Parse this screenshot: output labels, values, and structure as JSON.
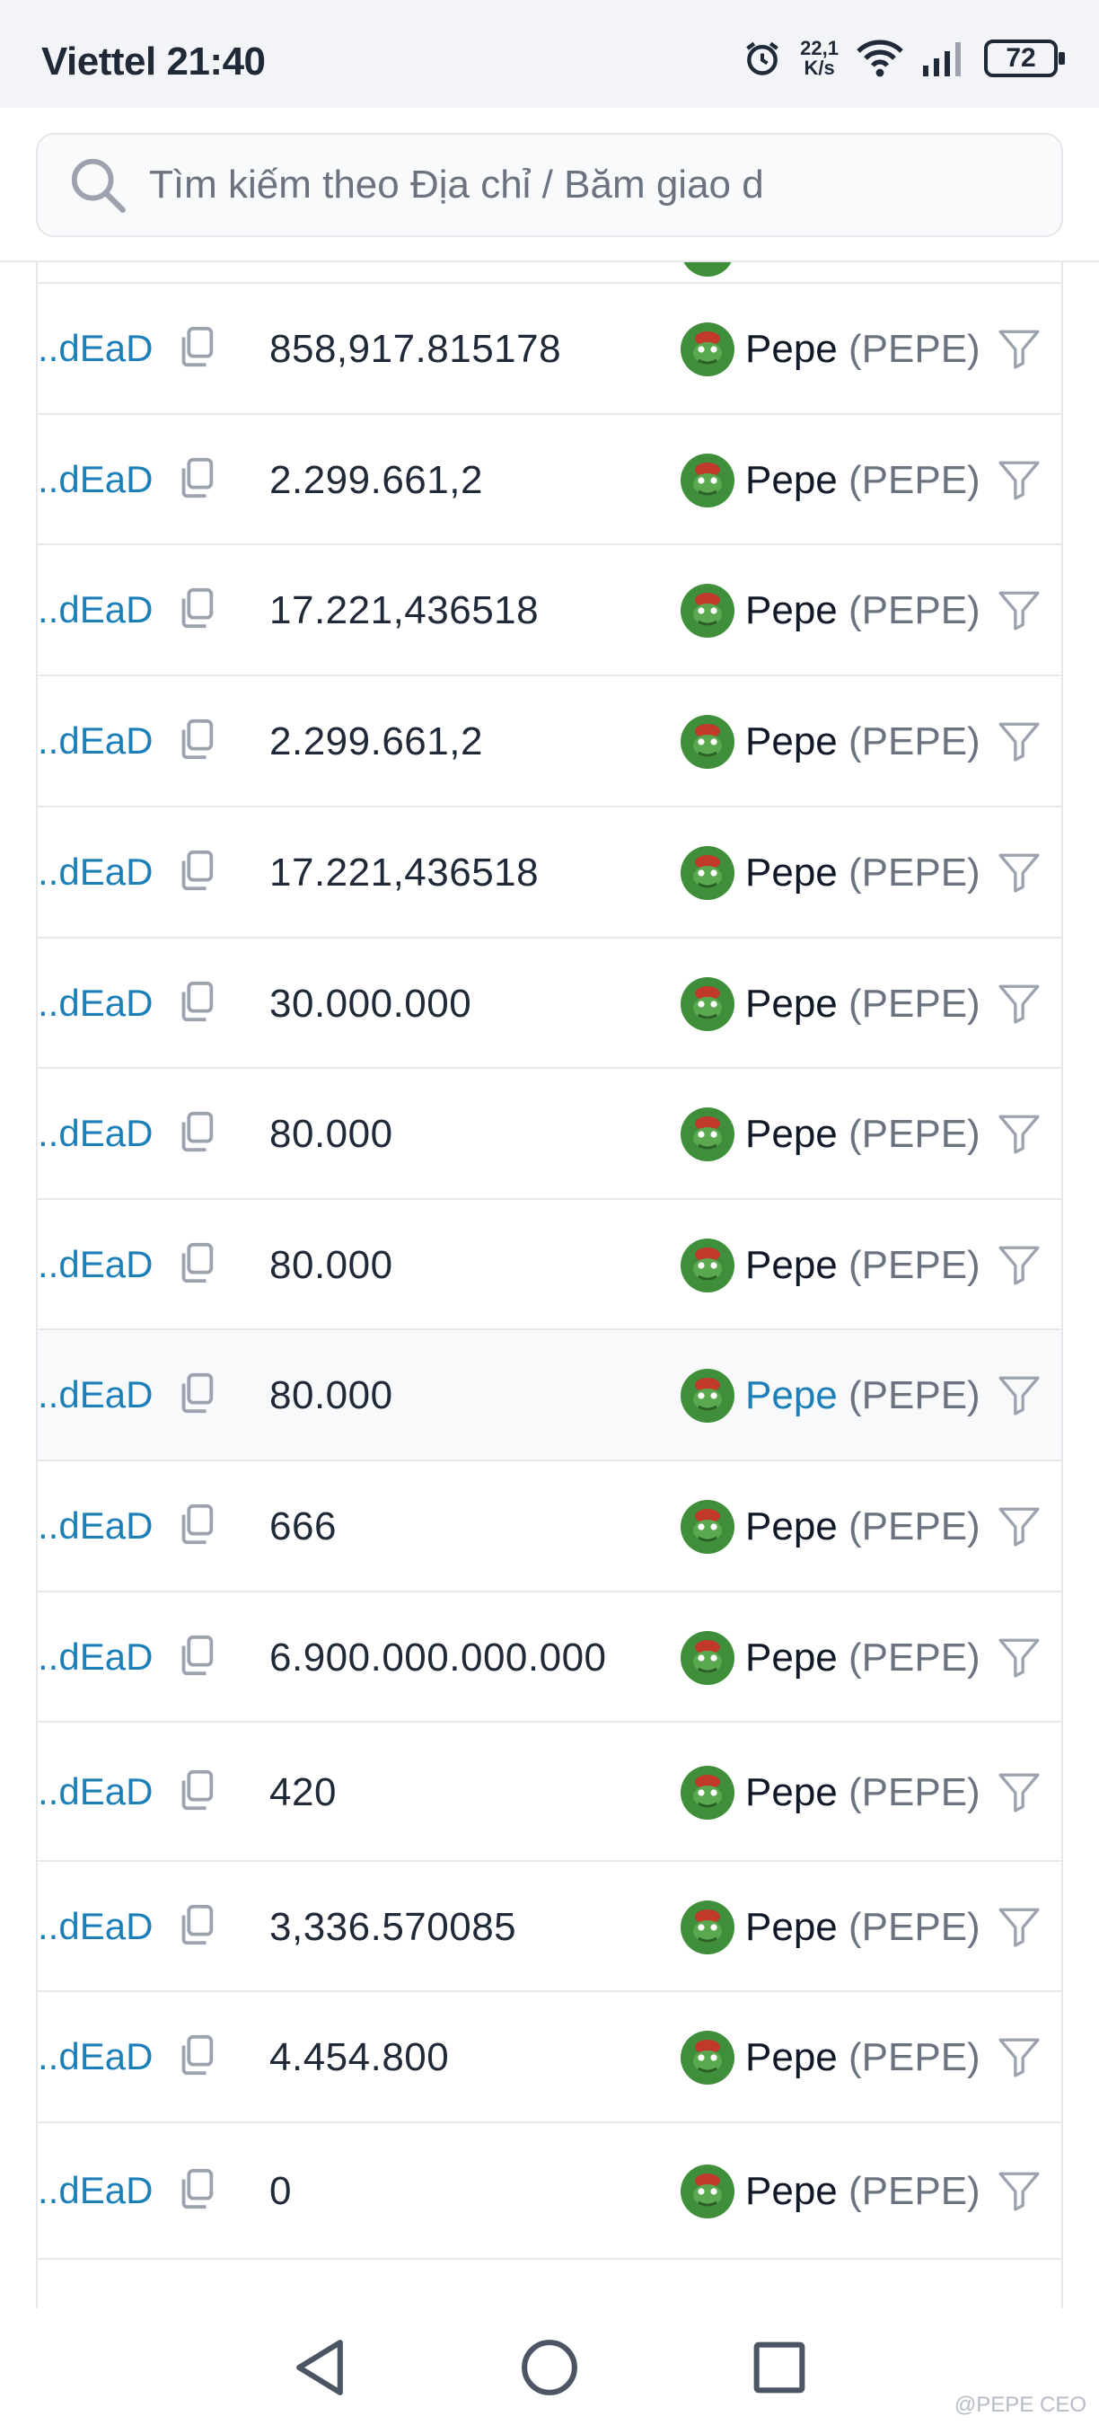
{
  "status_bar": {
    "carrier_time": "Viettel 21:40",
    "net_speed_value": "22,1",
    "net_speed_unit": "K/s",
    "battery": "72"
  },
  "search": {
    "placeholder": "Tìm kiếm theo Địa chỉ / Băm giao d"
  },
  "rows": [
    {
      "address": "..dEaD",
      "amount": "858,917.815178",
      "token_name": "Pepe",
      "token_symbol": "(PEPE)"
    },
    {
      "address": "..dEaD",
      "amount": "2.299.661,2",
      "token_name": "Pepe",
      "token_symbol": "(PEPE)"
    },
    {
      "address": "..dEaD",
      "amount": "17.221,436518",
      "token_name": "Pepe",
      "token_symbol": "(PEPE)"
    },
    {
      "address": "..dEaD",
      "amount": "2.299.661,2",
      "token_name": "Pepe",
      "token_symbol": "(PEPE)"
    },
    {
      "address": "..dEaD",
      "amount": "17.221,436518",
      "token_name": "Pepe",
      "token_symbol": "(PEPE)"
    },
    {
      "address": "..dEaD",
      "amount": "30.000.000",
      "token_name": "Pepe",
      "token_symbol": "(PEPE)"
    },
    {
      "address": "..dEaD",
      "amount": "80.000",
      "token_name": "Pepe",
      "token_symbol": "(PEPE)"
    },
    {
      "address": "..dEaD",
      "amount": "80.000",
      "token_name": "Pepe",
      "token_symbol": "(PEPE)"
    },
    {
      "address": "..dEaD",
      "amount": "80.000",
      "token_name": "Pepe",
      "token_symbol": "(PEPE)",
      "highlighted": true
    },
    {
      "address": "..dEaD",
      "amount": "666",
      "token_name": "Pepe",
      "token_symbol": "(PEPE)"
    },
    {
      "address": "..dEaD",
      "amount": "6.900.000.000.000",
      "token_name": "Pepe",
      "token_symbol": "(PEPE)"
    },
    {
      "address": "..dEaD",
      "amount": "420",
      "token_name": "Pepe",
      "token_symbol": "(PEPE)"
    },
    {
      "address": "..dEaD",
      "amount": "3,336.570085",
      "token_name": "Pepe",
      "token_symbol": "(PEPE)"
    },
    {
      "address": "..dEaD",
      "amount": "4.454.800",
      "token_name": "Pepe",
      "token_symbol": "(PEPE)"
    },
    {
      "address": "..dEaD",
      "amount": "0",
      "token_name": "Pepe",
      "token_symbol": "(PEPE)"
    }
  ],
  "watermark": "@PEPE CEO",
  "colors": {
    "link": "#1d7fb8",
    "token_logo": "#3f8f3a",
    "border": "#e5e7eb"
  }
}
